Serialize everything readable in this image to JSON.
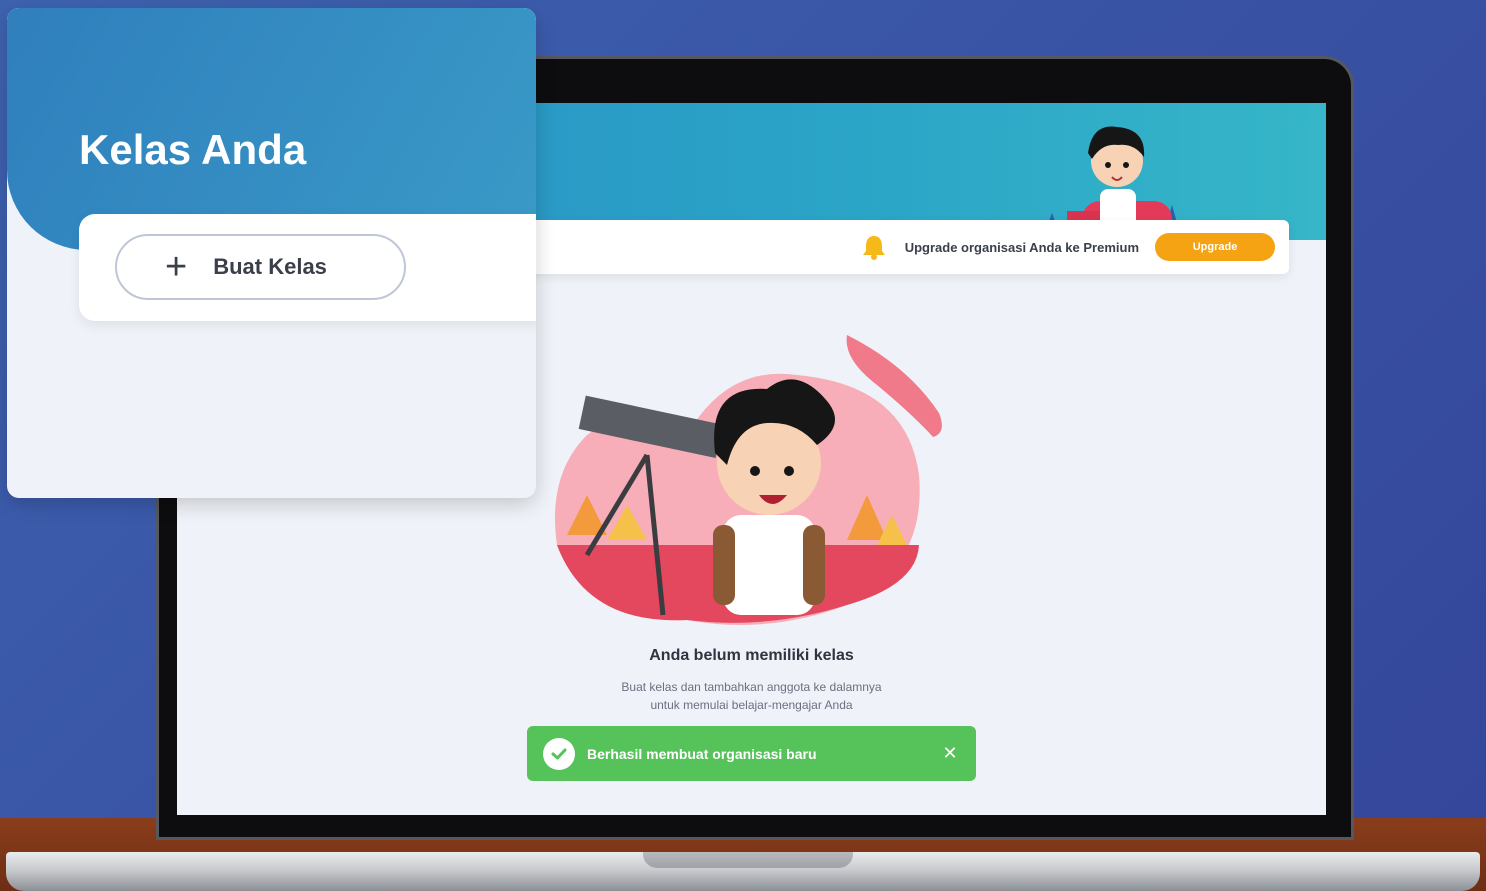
{
  "card": {
    "title": "Kelas Anda",
    "create_button": {
      "icon": "plus-icon",
      "label": "Buat Kelas"
    }
  },
  "banner": {
    "icon": "bell-icon",
    "text": "Upgrade organisasi Anda ke Premium",
    "button_label": "Upgrade"
  },
  "empty_state": {
    "title": "Anda belum memiliki kelas",
    "description_line1": "Buat kelas dan tambahkan anggota ke dalamnya",
    "description_line2": "untuk memulai belajar-mengajar Anda"
  },
  "toast": {
    "icon": "check-circle-icon",
    "message": "Berhasil membuat organisasi baru",
    "close_icon": "close-icon",
    "close_glyph": "✕"
  },
  "colors": {
    "primary_blue": "#2f7fbd",
    "upgrade_orange": "#f5a213",
    "success_green": "#56c35a"
  }
}
